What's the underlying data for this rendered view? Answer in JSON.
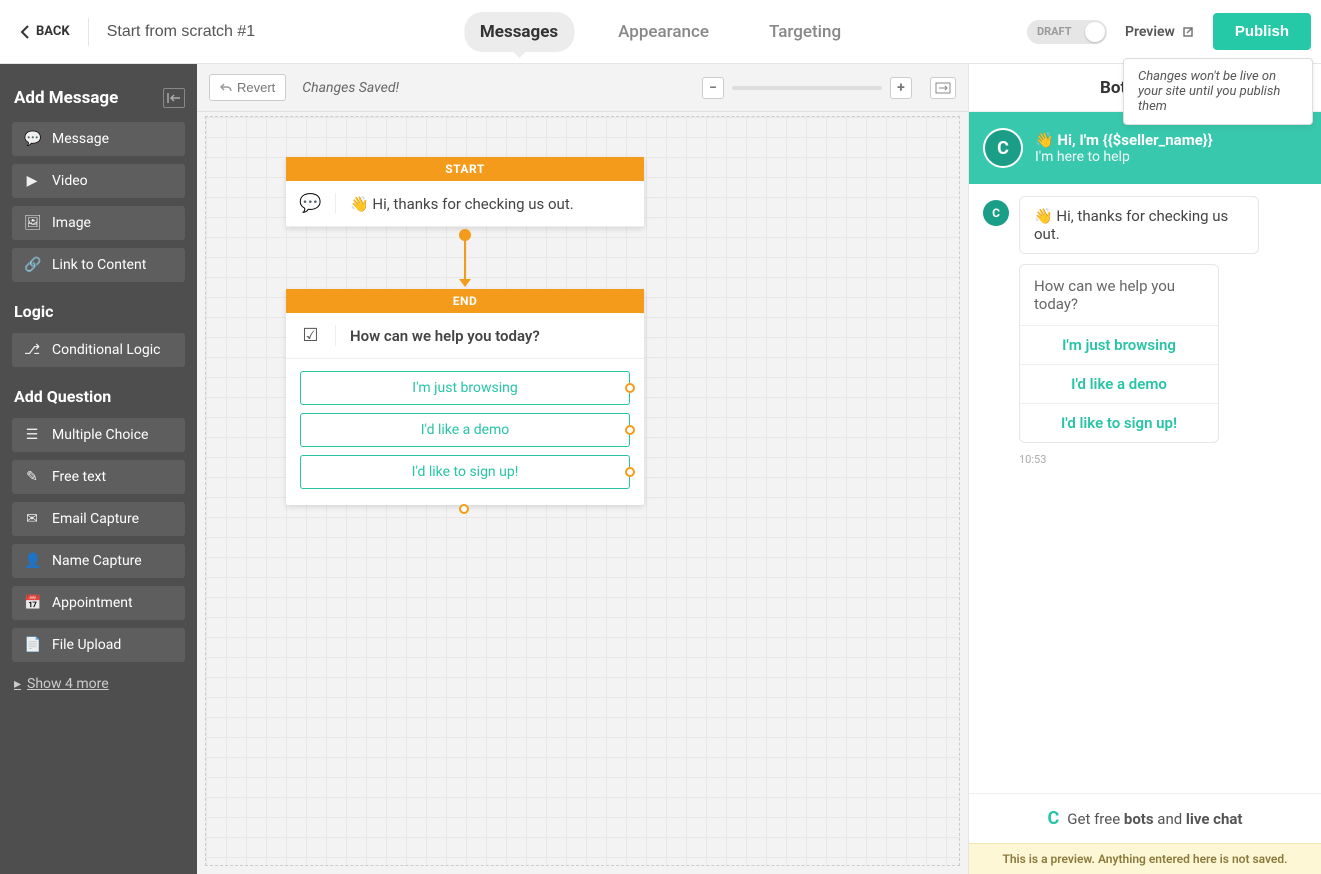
{
  "topbar": {
    "back": "BACK",
    "title": "Start from scratch #1",
    "tabs": {
      "messages": "Messages",
      "appearance": "Appearance",
      "targeting": "Targeting"
    },
    "draft": "DRAFT",
    "preview": "Preview",
    "publish": "Publish",
    "tooltip": "Changes won't be live on your site until you publish them"
  },
  "sidebar": {
    "addMessage": "Add Message",
    "items_msg": [
      {
        "label": "Message",
        "icon": "💬"
      },
      {
        "label": "Video",
        "icon": "▶"
      },
      {
        "label": "Image",
        "icon": "🖼"
      },
      {
        "label": "Link to Content",
        "icon": "🔗"
      }
    ],
    "logic": "Logic",
    "items_logic": [
      {
        "label": "Conditional Logic",
        "icon": "⎇"
      }
    ],
    "addQuestion": "Add Question",
    "items_q": [
      {
        "label": "Multiple Choice",
        "icon": "☰"
      },
      {
        "label": "Free text",
        "icon": "✎"
      },
      {
        "label": "Email Capture",
        "icon": "✉"
      },
      {
        "label": "Name Capture",
        "icon": "👤"
      },
      {
        "label": "Appointment",
        "icon": "📅"
      },
      {
        "label": "File Upload",
        "icon": "📄"
      }
    ],
    "showMore": "Show 4 more"
  },
  "canvasToolbar": {
    "revert": "Revert",
    "saved": "Changes Saved!"
  },
  "nodes": {
    "start": {
      "title": "START",
      "text": "Hi, thanks for checking us out."
    },
    "end": {
      "title": "END",
      "question": "How can we help you today?",
      "options": [
        "I'm just browsing",
        "I'd like a demo",
        "I'd like to sign up!"
      ]
    }
  },
  "preview": {
    "header": "Bot preview",
    "greet": {
      "line1": "👋 Hi, I'm {{$seller_name}}",
      "line2": "I'm here to help"
    },
    "bubble": "👋 Hi, thanks for checking us out.",
    "question": "How can we help you today?",
    "options": [
      "I'm just browsing",
      "I'd like a demo",
      "I'd like to sign up!"
    ],
    "timestamp": "10:53",
    "promo_prefix": "Get free ",
    "promo_bold1": "bots",
    "promo_mid": " and ",
    "promo_bold2": "live chat",
    "warning": "This is a preview. Anything entered here is not saved."
  }
}
